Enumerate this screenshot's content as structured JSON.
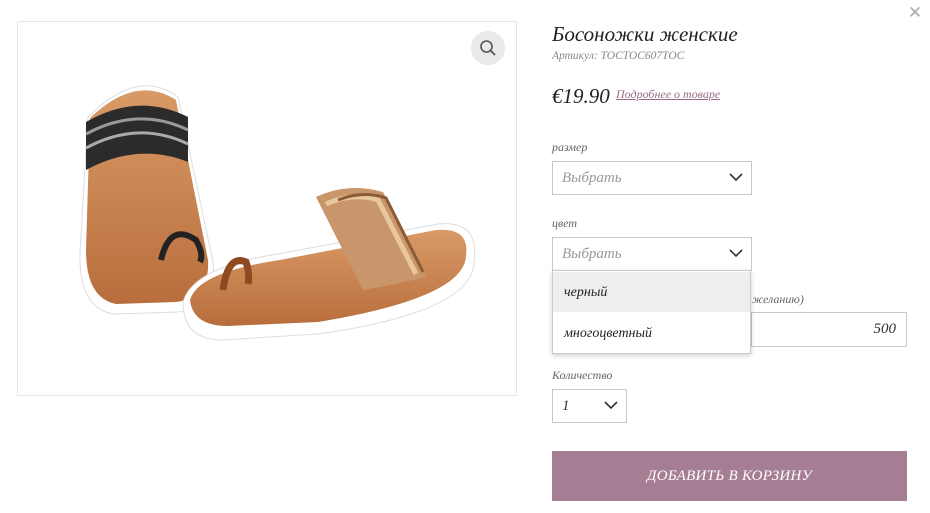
{
  "product": {
    "title": "Босоножки женские",
    "sku": "Артикул: TOCTOC607TOC",
    "price": "€19.90",
    "more_link": "Подробнее о товаре"
  },
  "size": {
    "label": "размер",
    "value": "Выбрать"
  },
  "color": {
    "label": "цвет",
    "value": "Выбрать",
    "options": [
      "черный",
      "многоцветный"
    ],
    "highlighted_option": "черный"
  },
  "extra": {
    "label_partial": "желанию)",
    "value": "500"
  },
  "quantity": {
    "label": "Количество",
    "value": "1"
  },
  "cart_button": {
    "label": "ДОБАВИТЬ В КОРЗИНУ"
  },
  "icons": {
    "close": "close-icon",
    "zoom": "search-icon",
    "chevron": "chevron-down-icon"
  },
  "colors": {
    "accent": "#a57e93",
    "link": "#9a6a88"
  }
}
